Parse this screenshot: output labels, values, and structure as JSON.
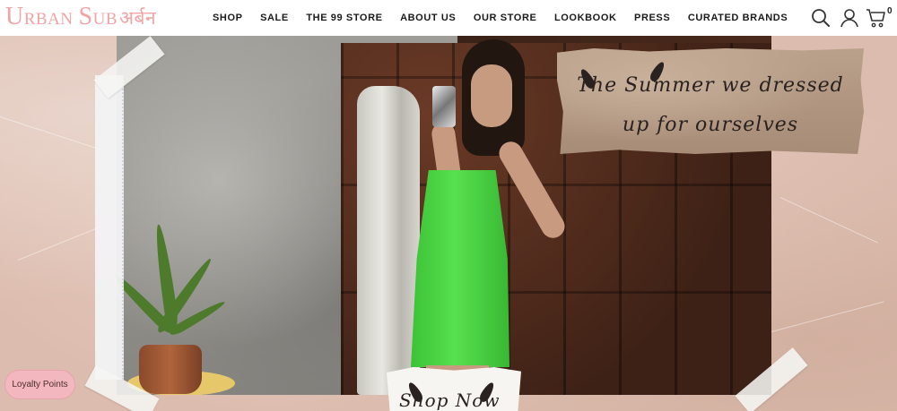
{
  "brand": {
    "part1_big": "U",
    "part1_small": "RBAN",
    "part2_big": "S",
    "part2_small": "UB",
    "part3": "अर्बन"
  },
  "nav": {
    "items": [
      {
        "label": "SHOP"
      },
      {
        "label": "SALE"
      },
      {
        "label": "THE 99 STORE"
      },
      {
        "label": "ABOUT US"
      },
      {
        "label": "OUR STORE"
      },
      {
        "label": "LOOKBOOK"
      },
      {
        "label": "PRESS"
      },
      {
        "label": "CURATED BRANDS"
      }
    ]
  },
  "header_icons": {
    "search": "search-icon",
    "account": "user-icon",
    "cart": "cart-icon",
    "cart_count": "0"
  },
  "hero": {
    "tagline_line1": "The Summer we dressed",
    "tagline_line2": "up for ourselves",
    "cta": "Shop Now",
    "dress_color": "#4ed246",
    "paper_color": "#e4c8bb"
  },
  "loyalty": {
    "label": "Loyalty Points",
    "color": "#f3b8bf"
  },
  "colors": {
    "brand_pink": "#f0a4a4",
    "nav_text": "#1a1a1a"
  }
}
